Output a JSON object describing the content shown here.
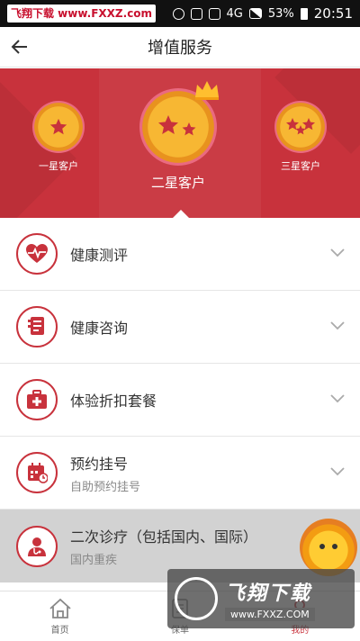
{
  "status_bar": {
    "watermark": "飞翔下载 www.FXXZ.com",
    "network": "4G",
    "battery": "53%",
    "time": "20:51"
  },
  "header": {
    "title": "增值服务"
  },
  "tiers": [
    {
      "label": "一星客户",
      "stars": 1
    },
    {
      "label": "二星客户",
      "stars": 2,
      "selected": true
    },
    {
      "label": "三星客户",
      "stars": 3
    }
  ],
  "services": [
    {
      "title": "健康测评",
      "subtitle": "",
      "icon": "heart-pulse-icon"
    },
    {
      "title": "健康咨询",
      "subtitle": "",
      "icon": "consult-icon"
    },
    {
      "title": "体验折扣套餐",
      "subtitle": "",
      "icon": "medical-kit-icon"
    },
    {
      "title": "预约挂号",
      "subtitle": "自助预约挂号",
      "icon": "calendar-icon"
    },
    {
      "title": "二次诊疗（包括国内、国际）",
      "subtitle": "国内重疾",
      "icon": "doctor-icon"
    }
  ],
  "bottom_nav": [
    {
      "label": "首页",
      "icon": "home-icon"
    },
    {
      "label": "保单",
      "icon": "policy-icon"
    },
    {
      "label": "我的",
      "icon": "user-icon",
      "active": true
    }
  ],
  "watermark": {
    "brand": "飞翔下载",
    "url": "www.FXXZ.COM"
  },
  "colors": {
    "brand_red": "#c8323c",
    "gold": "#f7b733"
  }
}
